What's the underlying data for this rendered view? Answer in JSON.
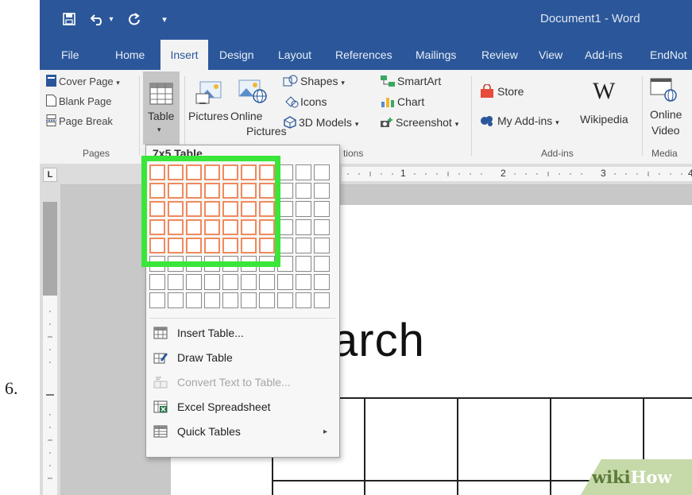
{
  "step_number": "6.",
  "window": {
    "title": "Document1  -  Word",
    "quick_access": [
      "save-icon",
      "undo-icon",
      "redo-icon",
      "customize-icon"
    ]
  },
  "tabs": [
    {
      "label": "File"
    },
    {
      "label": "Home"
    },
    {
      "label": "Insert",
      "active": true
    },
    {
      "label": "Design"
    },
    {
      "label": "Layout"
    },
    {
      "label": "References"
    },
    {
      "label": "Mailings"
    },
    {
      "label": "Review"
    },
    {
      "label": "View"
    },
    {
      "label": "Add-ins"
    },
    {
      "label": "EndNot"
    }
  ],
  "ribbon": {
    "pages": {
      "items": [
        "Cover Page",
        "Blank Page",
        "Page Break"
      ],
      "cover_arrow": "▾",
      "label": "Pages"
    },
    "table": {
      "label": "Table",
      "arrow": "▾"
    },
    "illustrations": {
      "pictures": "Pictures",
      "online_pictures_1": "Online",
      "online_pictures_2": "Pictures",
      "shapes": "Shapes",
      "icons": "Icons",
      "models": "3D Models",
      "smartart": "SmartArt",
      "chart": "Chart",
      "screenshot": "Screenshot",
      "label": "tions"
    },
    "addins": {
      "store": "Store",
      "my_addins": "My Add-ins",
      "wikipedia": "Wikipedia",
      "wikipedia_logo": "W",
      "label": "Add-ins"
    },
    "media": {
      "online_video_1": "Online",
      "online_video_2": "Video",
      "label": "Media"
    }
  },
  "ruler": {
    "numbers": [
      "1",
      "2",
      "3",
      "4"
    ],
    "tab_selector": "L"
  },
  "table_dropdown": {
    "header": "7x5 Table",
    "grid": {
      "columns": 10,
      "rows": 8,
      "selected_columns": 7,
      "selected_rows": 5
    },
    "menu": [
      {
        "label": "Insert Table...",
        "icon": "insert-table-icon",
        "enabled": true
      },
      {
        "label": "Draw Table",
        "icon": "draw-table-icon",
        "enabled": true
      },
      {
        "label": "Convert Text to Table...",
        "icon": "convert-text-icon",
        "enabled": false
      },
      {
        "label": "Excel Spreadsheet",
        "icon": "excel-icon",
        "enabled": true
      },
      {
        "label": "Quick Tables",
        "icon": "quick-tables-icon",
        "enabled": true,
        "submenu_arrow": "▸"
      }
    ]
  },
  "document": {
    "heading_text": "arch"
  },
  "watermark": {
    "part1": "wiki",
    "part2": "How"
  },
  "colors": {
    "word_blue": "#2b579a",
    "highlight_green": "#39e639",
    "selected_cell_orange": "#f08a5d"
  }
}
